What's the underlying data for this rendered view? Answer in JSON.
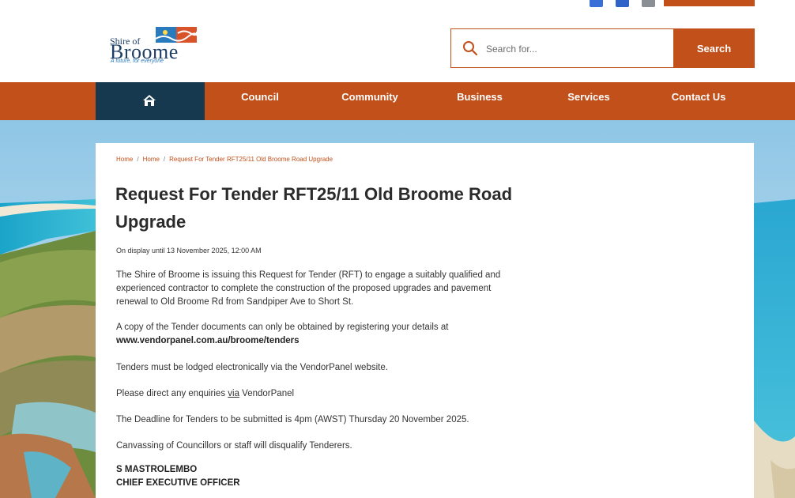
{
  "header": {
    "logo": {
      "prefix": "Shire of",
      "name": "Broome",
      "tagline": "A future, for everyone"
    },
    "search": {
      "placeholder": "Search for...",
      "button_label": "Search"
    },
    "social_icons": [
      "facebook-icon",
      "linkedin-icon",
      "email-icon"
    ]
  },
  "nav": {
    "home_icon": "home-icon",
    "items": [
      {
        "label": "Council"
      },
      {
        "label": "Community"
      },
      {
        "label": "Business"
      },
      {
        "label": "Services"
      },
      {
        "label": "Contact Us"
      }
    ]
  },
  "breadcrumb": [
    "Home",
    "Home",
    "Request For Tender RFT25/11 Old Broome Road Upgrade"
  ],
  "article": {
    "title": "Request For Tender RFT25/11 Old Broome Road Upgrade",
    "display_until": "On display until 13 November 2025, 12:00 AM",
    "p1": "The Shire of Broome is issuing this Request for Tender (RFT) to engage a suitably qualified and experienced contractor to complete the construction of the proposed upgrades and pavement renewal to Old Broome Rd from Sandpiper Ave to Short St.",
    "p2_text": "A copy of the Tender documents can only be obtained by registering your details at",
    "p2_link": "www.vendorpanel.com.au/broome/tenders",
    "p3": "Tenders must be lodged electronically via the VendorPanel website.",
    "p4_before": "Please direct any enquiries ",
    "p4_link": "via",
    "p4_after": " VendorPanel",
    "p5": "The Deadline for Tenders to be submitted is 4pm (AWST) Thursday 20 November 2025.",
    "p6": "Canvassing of Councillors or staff will disqualify Tenderers.",
    "signer_name": "S MASTROLEMBO",
    "signer_title": "CHIEF EXECUTIVE OFFICER"
  },
  "colors": {
    "brand_orange": "#c2501a",
    "home_tab": "#16394f",
    "text": "#333333"
  }
}
